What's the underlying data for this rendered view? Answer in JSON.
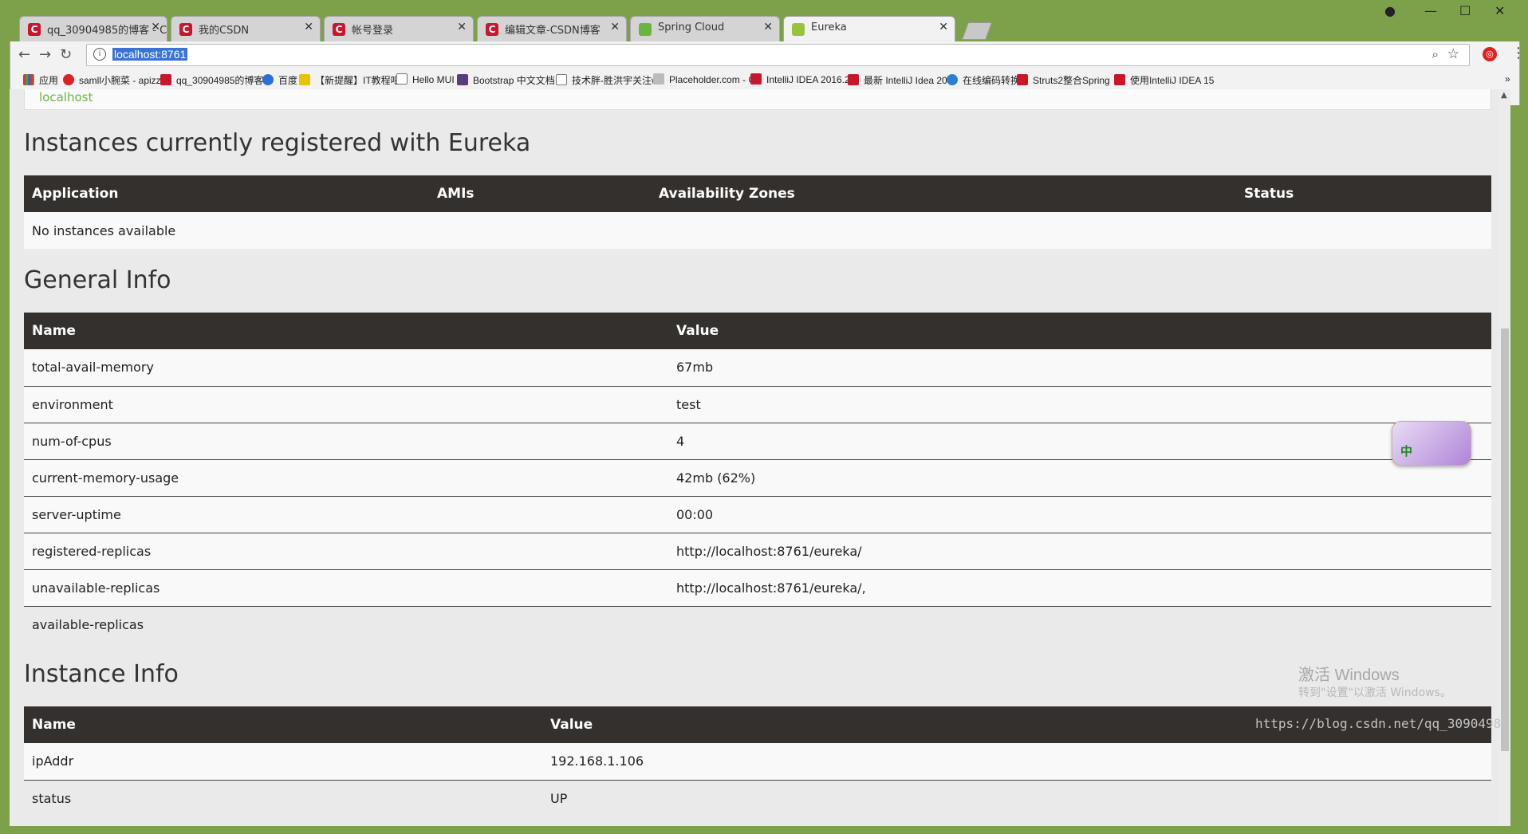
{
  "browser": {
    "tabs": [
      {
        "label": "qq_30904985的博客 - C",
        "favicon": "csdn-icon",
        "active": false
      },
      {
        "label": "我的CSDN",
        "favicon": "csdn-icon",
        "active": false
      },
      {
        "label": "帐号登录",
        "favicon": "csdn-icon",
        "active": false
      },
      {
        "label": "编辑文章-CSDN博客",
        "favicon": "csdn-icon",
        "active": false
      },
      {
        "label": "Spring Cloud",
        "favicon": "spring-icon",
        "active": false
      },
      {
        "label": "Eureka",
        "favicon": "eureka-leaf-icon",
        "active": true
      }
    ],
    "address": "localhost:8761",
    "bookmarks": [
      "应用",
      "samll小腕菜 - apizz",
      "qq_30904985的博客",
      "百度",
      "【新提醒】IT教程吧-",
      "Hello MUI",
      "Bootstrap 中文文档",
      "技术胖-胜洪宇关注w",
      "Placeholder.com - C",
      "IntelliJ IDEA 2016.2",
      "最新 IntelliJ Idea 20",
      "在线编码转换",
      "Struts2整合Spring",
      "使用IntelliJ IDEA 15"
    ]
  },
  "page": {
    "top_host": "localhost",
    "instances": {
      "heading": "Instances currently registered with Eureka",
      "columns": [
        "Application",
        "AMIs",
        "Availability Zones",
        "Status"
      ],
      "empty_text": "No instances available"
    },
    "general": {
      "heading": "General Info",
      "columns": [
        "Name",
        "Value"
      ],
      "rows": [
        {
          "name": "total-avail-memory",
          "value": "67mb"
        },
        {
          "name": "environment",
          "value": "test"
        },
        {
          "name": "num-of-cpus",
          "value": "4"
        },
        {
          "name": "current-memory-usage",
          "value": "42mb (62%)"
        },
        {
          "name": "server-uptime",
          "value": "00:00"
        },
        {
          "name": "registered-replicas",
          "value": "http://localhost:8761/eureka/"
        },
        {
          "name": "unavailable-replicas",
          "value": "http://localhost:8761/eureka/,"
        },
        {
          "name": "available-replicas",
          "value": ""
        }
      ]
    },
    "instance_info": {
      "heading": "Instance Info",
      "columns": [
        "Name",
        "Value"
      ],
      "rows": [
        {
          "name": "ipAddr",
          "value": "192.168.1.106"
        },
        {
          "name": "status",
          "value": "UP"
        }
      ]
    }
  },
  "overlay": {
    "ime_label": "中",
    "activation_title": "激活 Windows",
    "activation_sub": "转到\"设置\"以激活 Windows。",
    "blog_watermark": "https://blog.csdn.net/qq_3090498"
  }
}
